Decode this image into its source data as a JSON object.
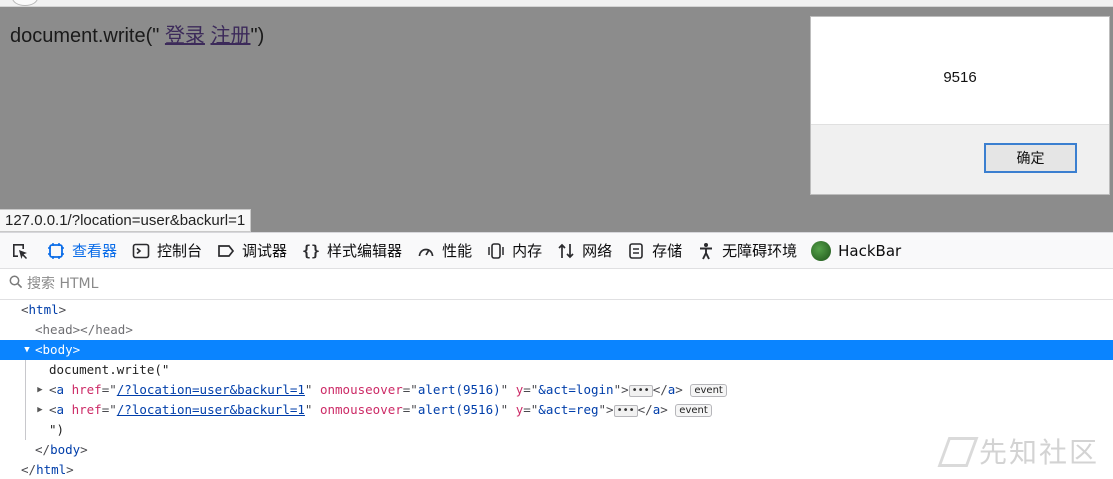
{
  "page": {
    "text_before": "document.write(\" ",
    "link_login": "登录",
    "link_register": "注册",
    "text_after": "\")",
    "status_url": "127.0.0.1/?location=user&backurl=1"
  },
  "dialog": {
    "message": "9516",
    "ok_label": "确定"
  },
  "devtools": {
    "tabs": [
      {
        "label": "查看器",
        "icon": "inspector-icon",
        "active": true
      },
      {
        "label": "控制台",
        "icon": "console-icon"
      },
      {
        "label": "调试器",
        "icon": "debugger-icon"
      },
      {
        "label": "样式编辑器",
        "icon": "style-editor-icon"
      },
      {
        "label": "性能",
        "icon": "performance-icon"
      },
      {
        "label": "内存",
        "icon": "memory-icon"
      },
      {
        "label": "网络",
        "icon": "network-icon"
      },
      {
        "label": "存储",
        "icon": "storage-icon"
      },
      {
        "label": "无障碍环境",
        "icon": "accessibility-icon"
      },
      {
        "label": "HackBar",
        "icon": "hackbar-icon"
      }
    ],
    "search_placeholder": "搜索 HTML"
  },
  "tree": {
    "html_open": "html",
    "head": "head",
    "body_open": "body",
    "text1": "document.write(\"",
    "a1": {
      "href": "/?location=user&backurl=1",
      "onmouseover": "alert(9516)",
      "y": "&act=login",
      "badge": "event"
    },
    "a2": {
      "href": "/?location=user&backurl=1",
      "onmouseover": "alert(9516)",
      "y": "&act=reg",
      "badge": "event"
    },
    "text2": "\")",
    "body_close": "body",
    "html_close": "html"
  },
  "watermark": "先知社区"
}
